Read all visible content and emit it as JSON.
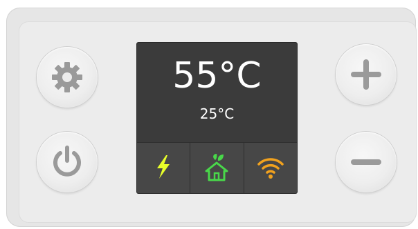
{
  "display": {
    "main_temperature": "55°C",
    "sub_temperature": "25°C"
  },
  "status_icons": [
    {
      "icon": "lightning-icon",
      "color": "#e8ff2a"
    },
    {
      "icon": "eco-home-icon",
      "color": "#49d84a"
    },
    {
      "icon": "wifi-icon",
      "color": "#f2a21e"
    }
  ],
  "buttons": [
    {
      "icon": "gear-icon"
    },
    {
      "icon": "power-icon"
    },
    {
      "icon": "plus-icon"
    },
    {
      "icon": "minus-icon"
    }
  ],
  "colors": {
    "device_body": "#e6e6e6",
    "screen_background": "#3b3b3b",
    "button_icon": "#9a9a9a"
  }
}
